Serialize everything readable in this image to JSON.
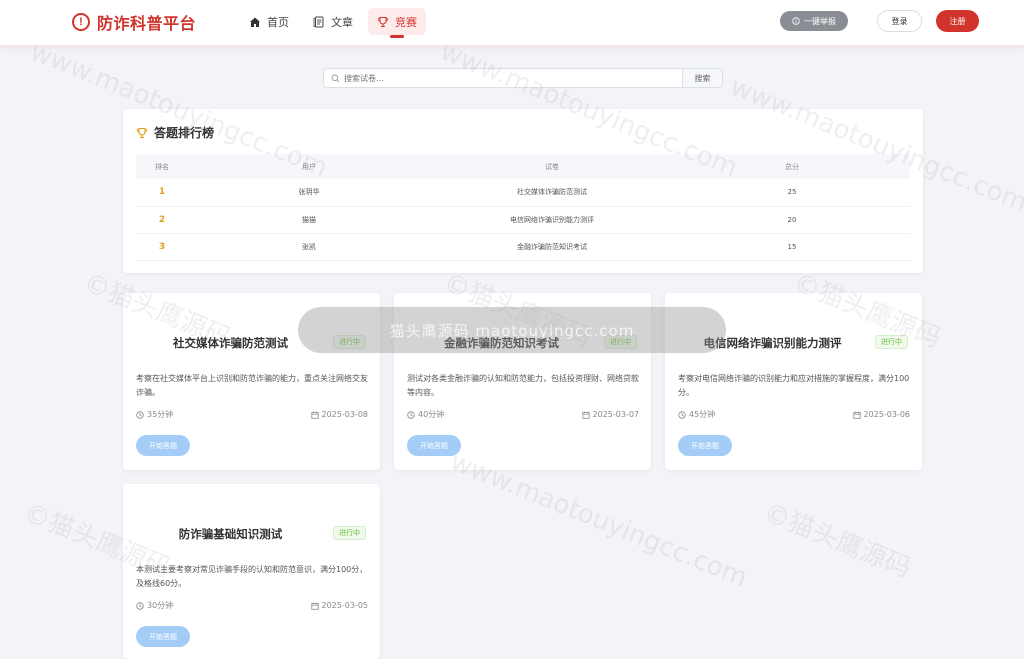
{
  "header": {
    "logo_text": "防诈科普平台",
    "logo_icon": "exclamation-circle-icon",
    "nav": [
      {
        "label": "首页",
        "icon": "home-icon",
        "active": false
      },
      {
        "label": "文章",
        "icon": "document-icon",
        "active": false
      },
      {
        "label": "竞赛",
        "icon": "trophy-icon",
        "active": true
      }
    ],
    "report_label": "一键举报",
    "login_label": "登录",
    "register_label": "注册"
  },
  "search": {
    "placeholder": "搜索试卷...",
    "button_label": "搜索"
  },
  "leaderboard": {
    "title": "答题排行榜",
    "columns": [
      "排名",
      "用户",
      "试卷",
      "总分"
    ],
    "rows": [
      {
        "rank": "1",
        "user": "张玥华",
        "paper": "社交媒体诈骗防范测试",
        "score": "25"
      },
      {
        "rank": "2",
        "user": "猫猫",
        "paper": "电信网络诈骗识别能力测评",
        "score": "20"
      },
      {
        "rank": "3",
        "user": "张凯",
        "paper": "金融诈骗防范知识考试",
        "score": "15"
      }
    ]
  },
  "cards": [
    {
      "title": "社交媒体诈骗防范测试",
      "status": "进行中",
      "desc": "考察在社交媒体平台上识别和防范诈骗的能力，重点关注网络交友诈骗。",
      "duration": "35分钟",
      "date": "2025-03-08",
      "button": "开始答题"
    },
    {
      "title": "金融诈骗防范知识考试",
      "status": "进行中",
      "desc": "测试对各类金融诈骗的认知和防范能力，包括投资理财、网络贷款等内容。",
      "duration": "40分钟",
      "date": "2025-03-07",
      "button": "开始答题"
    },
    {
      "title": "电信网络诈骗识别能力测评",
      "status": "进行中",
      "desc": "考察对电信网络诈骗的识别能力和应对措施的掌握程度，满分100分。",
      "duration": "45分钟",
      "date": "2025-03-06",
      "button": "开始答题"
    },
    {
      "title": "防诈骗基础知识测试",
      "status": "进行中",
      "desc": "本测试主要考察对常见诈骗手段的认知和防范意识，满分100分，及格线60分。",
      "duration": "30分钟",
      "date": "2025-03-05",
      "button": "开始答题"
    }
  ],
  "watermark": {
    "banner": "猫头鹰源码 maotouyingcc.com",
    "url_text": "www.maotouyingcc.com",
    "cn_text": "©猫头鹰源码"
  },
  "colors": {
    "brand": "#d0342c",
    "rank": "#e0a21a",
    "badge": "#67c23a",
    "button": "#a3cdf7"
  }
}
